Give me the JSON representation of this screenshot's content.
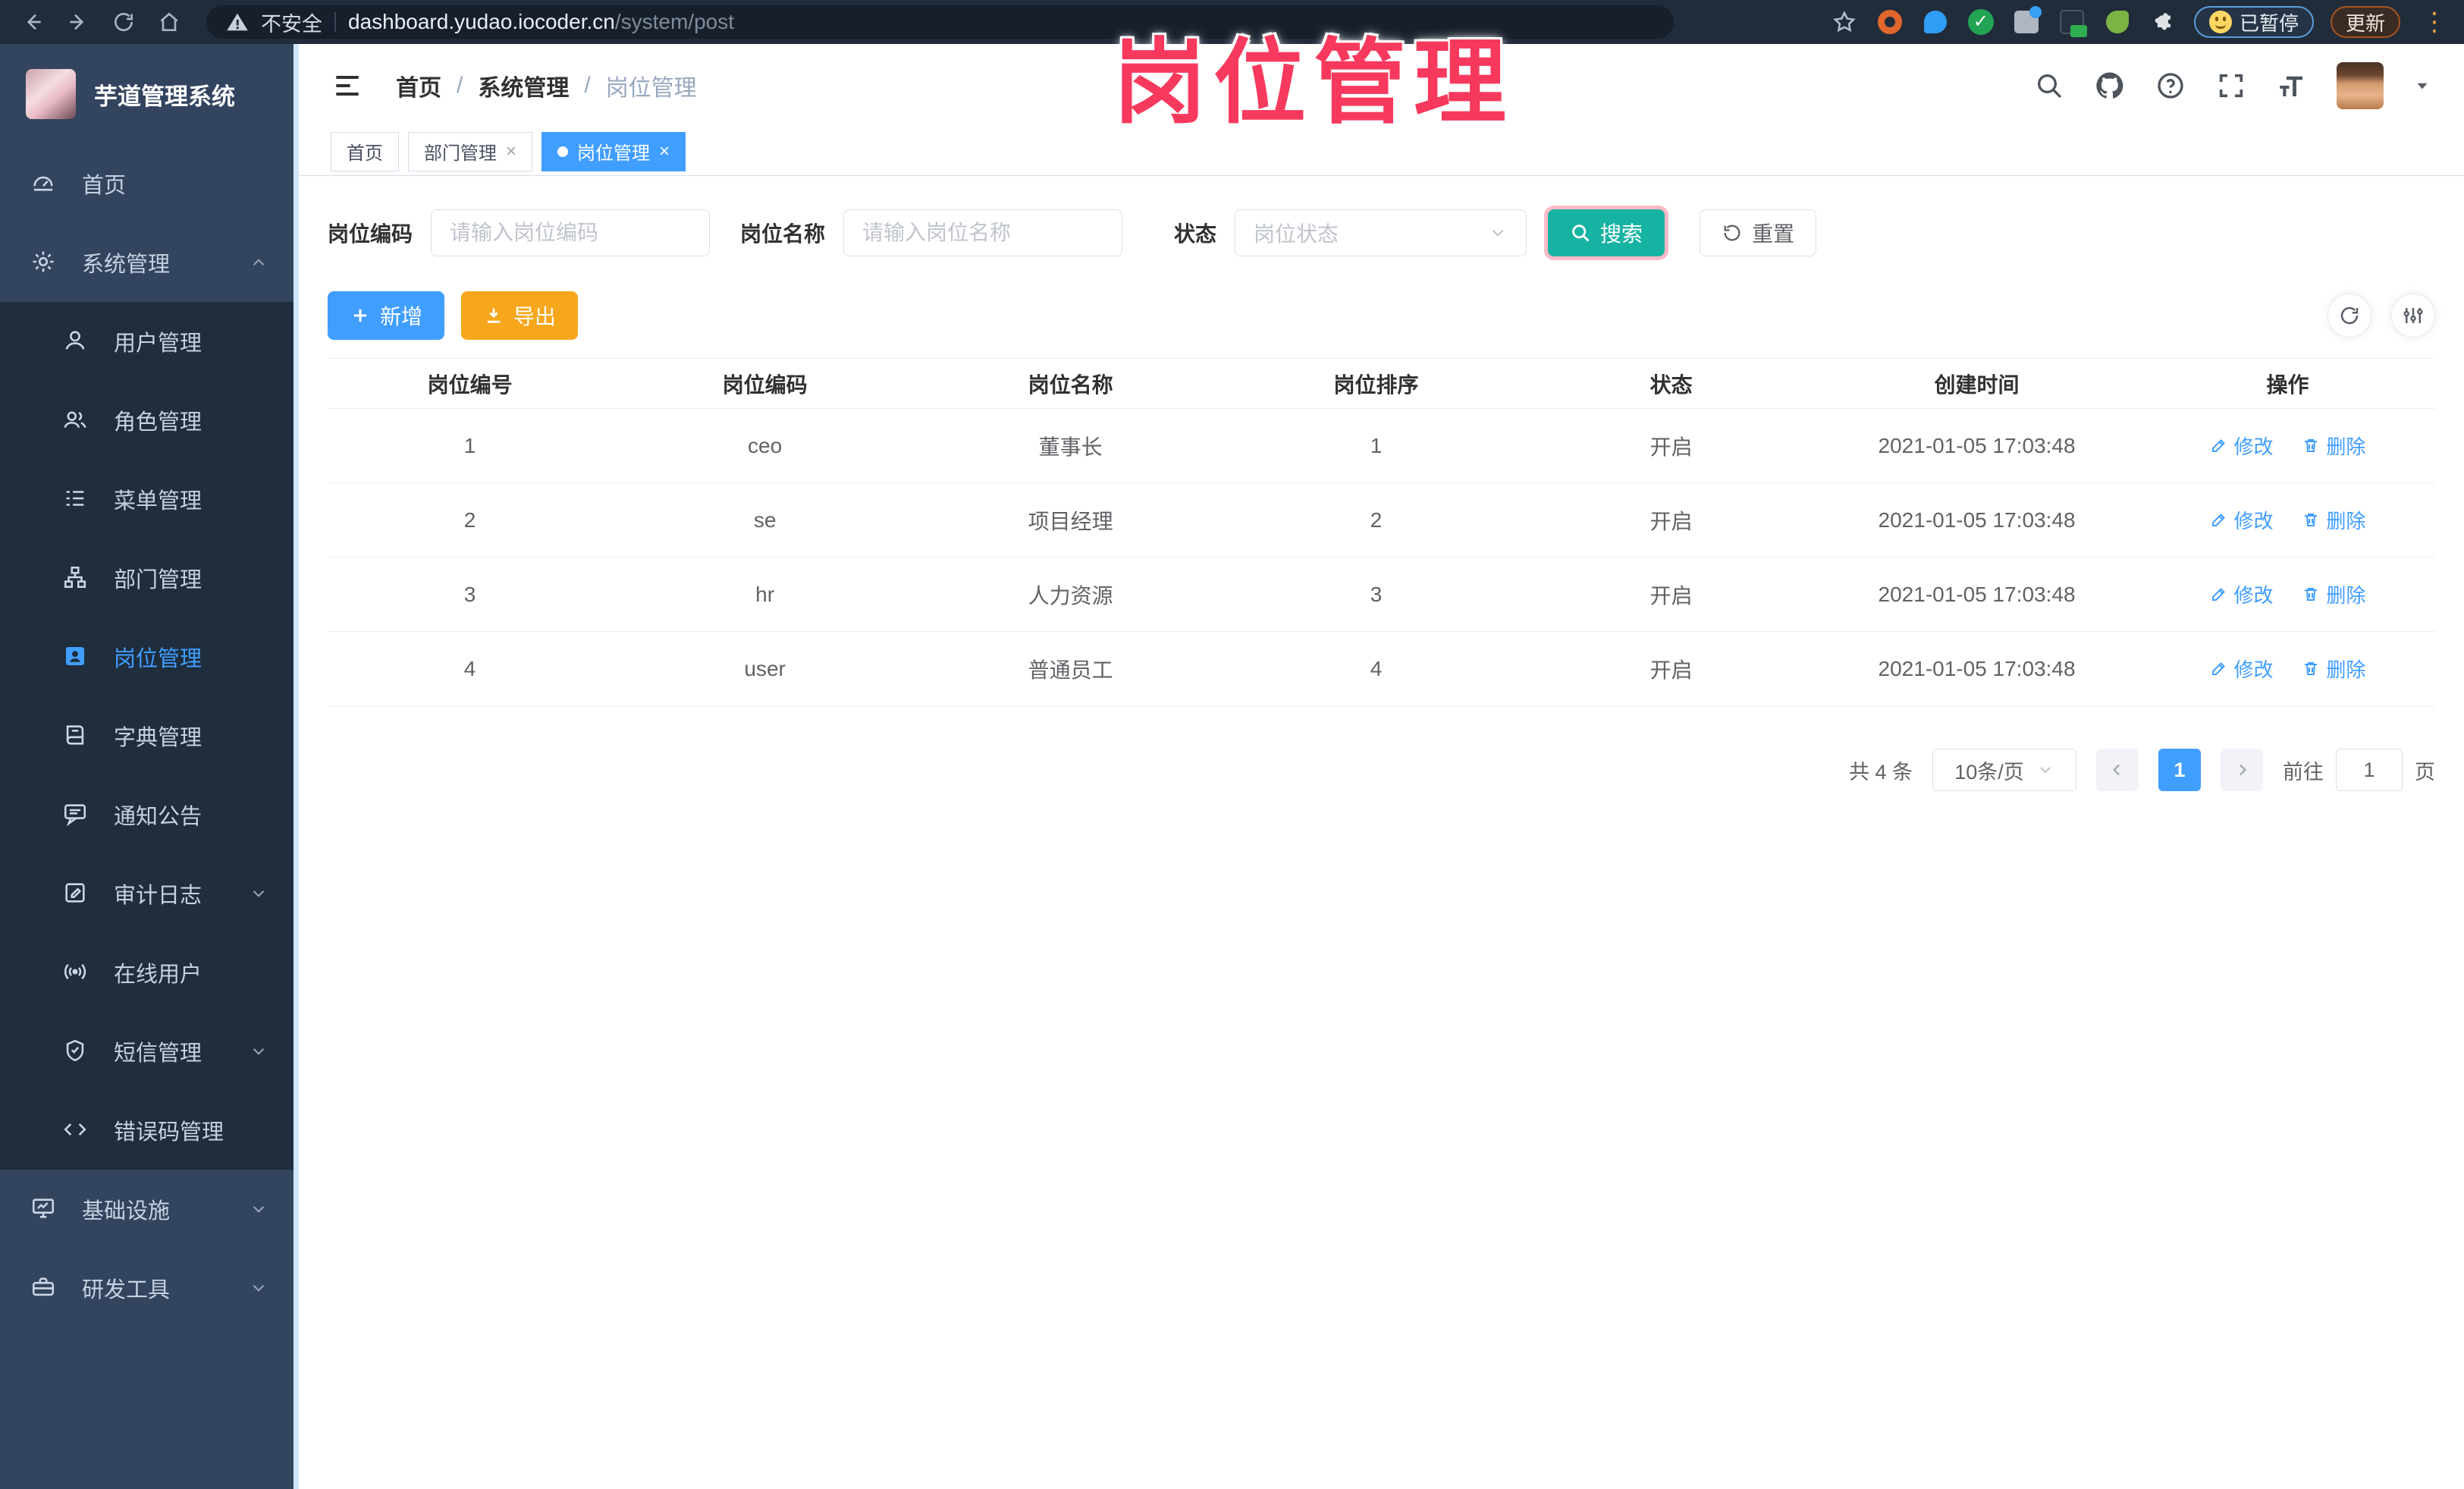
{
  "browser": {
    "security_label": "不安全",
    "url_host": "dashboard.yudao.iocoder.cn",
    "url_path": "/system/post",
    "paused_badge": "已暂停",
    "update_label": "更新"
  },
  "annotation": {
    "text": "岗位管理"
  },
  "sidebar": {
    "app_title": "芋道管理系统",
    "items": [
      {
        "label": "首页",
        "icon": "dashboard-icon",
        "type": "root"
      },
      {
        "label": "系统管理",
        "icon": "gear-icon",
        "type": "root",
        "expanded": true
      },
      {
        "label": "用户管理",
        "icon": "user-icon",
        "type": "sub"
      },
      {
        "label": "角色管理",
        "icon": "role-icon",
        "type": "sub"
      },
      {
        "label": "菜单管理",
        "icon": "menu-list-icon",
        "type": "sub"
      },
      {
        "label": "部门管理",
        "icon": "dept-tree-icon",
        "type": "sub"
      },
      {
        "label": "岗位管理",
        "icon": "post-badge-icon",
        "type": "sub",
        "active": true
      },
      {
        "label": "字典管理",
        "icon": "dict-book-icon",
        "type": "sub"
      },
      {
        "label": "通知公告",
        "icon": "notice-icon",
        "type": "sub"
      },
      {
        "label": "审计日志",
        "icon": "audit-log-icon",
        "type": "sub",
        "collapsible": true
      },
      {
        "label": "在线用户",
        "icon": "online-users-icon",
        "type": "sub"
      },
      {
        "label": "短信管理",
        "icon": "sms-shield-icon",
        "type": "sub",
        "collapsible": true
      },
      {
        "label": "错误码管理",
        "icon": "error-code-icon",
        "type": "sub"
      },
      {
        "label": "基础设施",
        "icon": "infrastructure-icon",
        "type": "root",
        "collapsible": true
      },
      {
        "label": "研发工具",
        "icon": "dev-tools-icon",
        "type": "root",
        "collapsible": true
      }
    ]
  },
  "breadcrumb": {
    "items": [
      "首页",
      "系统管理",
      "岗位管理"
    ]
  },
  "tabs": [
    {
      "label": "首页",
      "closable": false,
      "active": false
    },
    {
      "label": "部门管理",
      "closable": true,
      "active": false
    },
    {
      "label": "岗位管理",
      "closable": true,
      "active": true
    }
  ],
  "filters": {
    "post_code_label": "岗位编码",
    "post_code_placeholder": "请输入岗位编码",
    "post_name_label": "岗位名称",
    "post_name_placeholder": "请输入岗位名称",
    "status_label": "状态",
    "status_placeholder": "岗位状态",
    "search_label": "搜索",
    "reset_label": "重置"
  },
  "toolbar": {
    "add_label": "新增",
    "export_label": "导出"
  },
  "table": {
    "columns": [
      "岗位编号",
      "岗位编码",
      "岗位名称",
      "岗位排序",
      "状态",
      "创建时间",
      "操作"
    ],
    "rows": [
      {
        "id": "1",
        "code": "ceo",
        "name": "董事长",
        "sort": "1",
        "status": "开启",
        "created": "2021-01-05 17:03:48"
      },
      {
        "id": "2",
        "code": "se",
        "name": "项目经理",
        "sort": "2",
        "status": "开启",
        "created": "2021-01-05 17:03:48"
      },
      {
        "id": "3",
        "code": "hr",
        "name": "人力资源",
        "sort": "3",
        "status": "开启",
        "created": "2021-01-05 17:03:48"
      },
      {
        "id": "4",
        "code": "user",
        "name": "普通员工",
        "sort": "4",
        "status": "开启",
        "created": "2021-01-05 17:03:48"
      }
    ],
    "edit_label": "修改",
    "delete_label": "删除"
  },
  "pagination": {
    "total_label": "共 4 条",
    "page_size": "10条/页",
    "current_page": "1",
    "goto_label": "前往",
    "goto_value": "1",
    "page_suffix": "页"
  },
  "colors": {
    "accent_blue": "#409eff",
    "search_teal": "#16b3a3",
    "export_orange": "#f7a71c",
    "annotation_pink": "#f8395e",
    "sidebar_bg": "#33445f",
    "submenu_bg": "#1f2d3d",
    "browser_bar_bg": "#212c3b"
  }
}
